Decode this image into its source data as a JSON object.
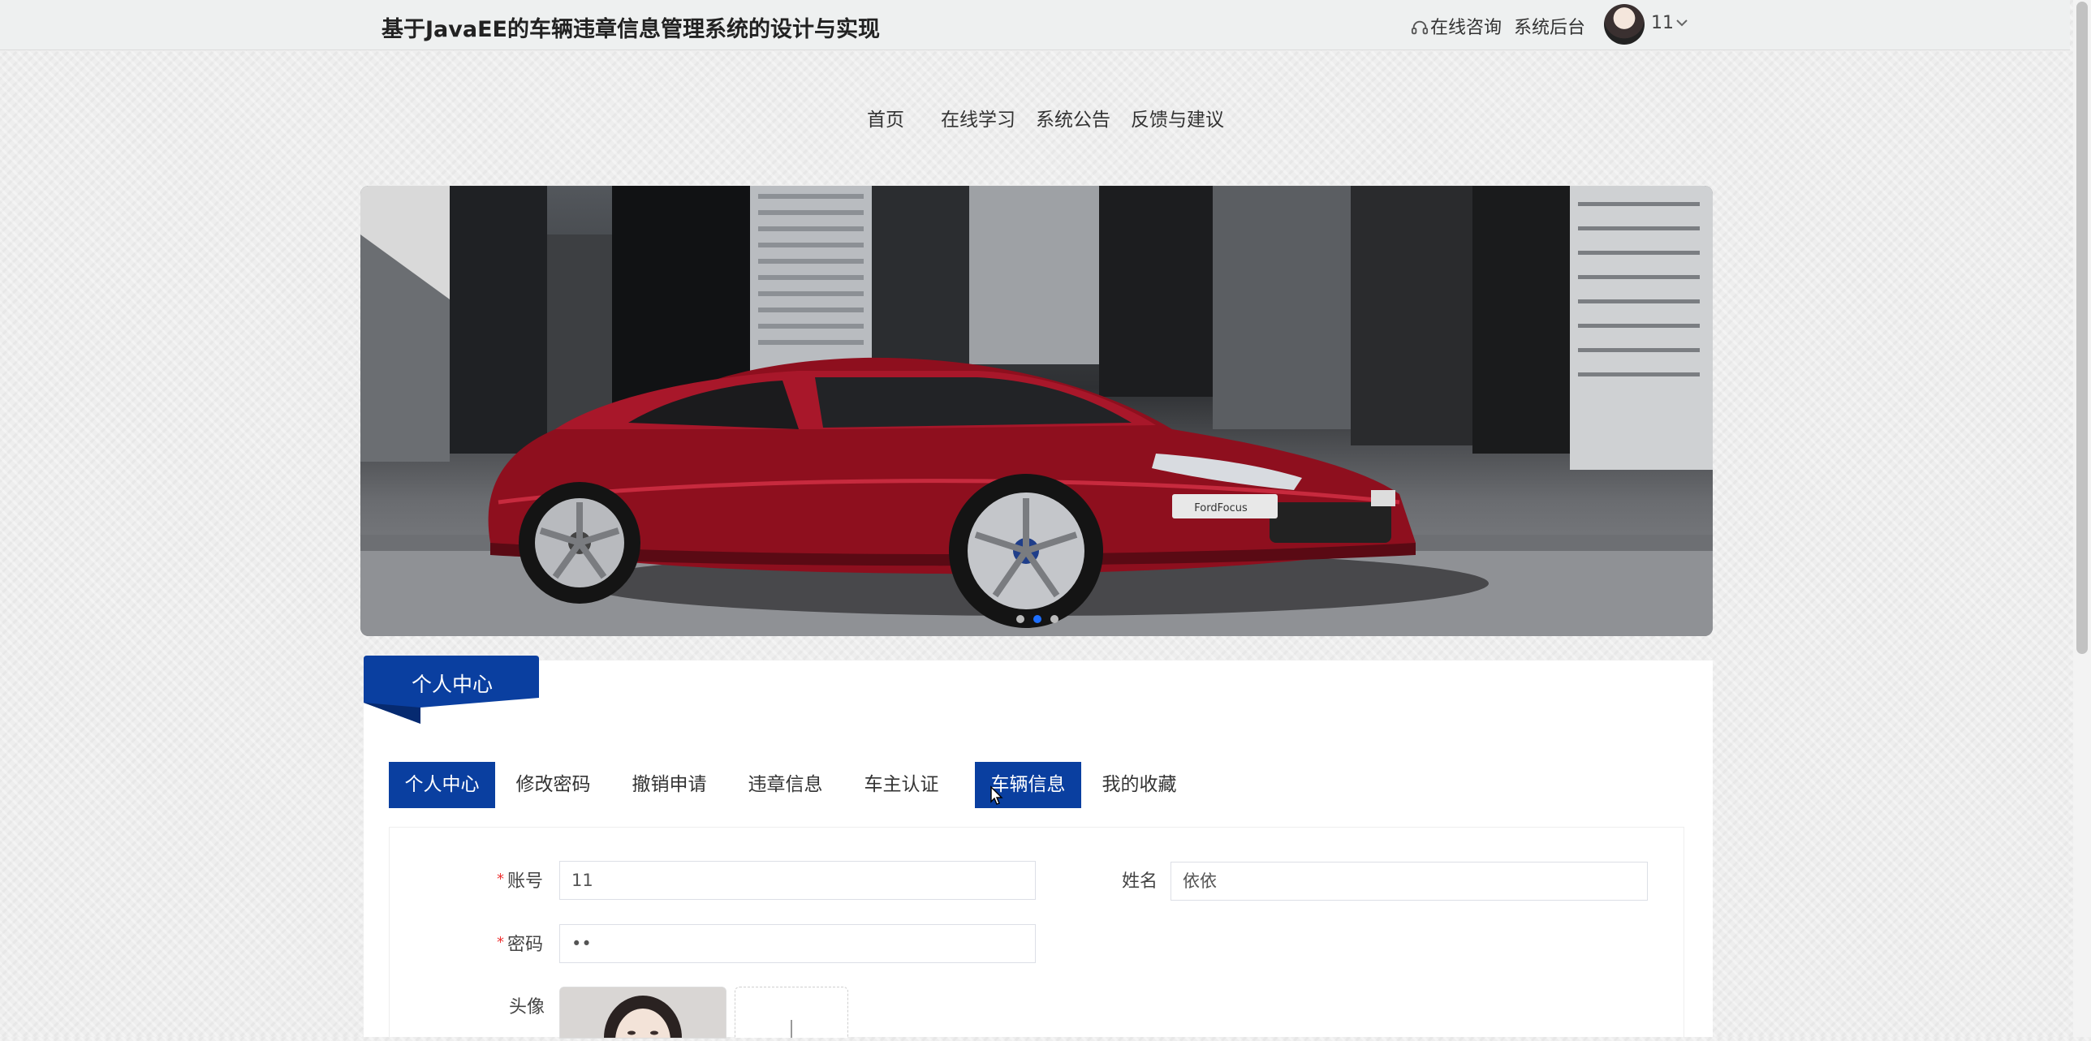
{
  "header": {
    "site_title": "基于JavaEE的车辆违章信息管理系统的设计与实现",
    "consult_label": "在线咨询",
    "backend_label": "系统后台",
    "username": "11"
  },
  "nav": {
    "items": [
      {
        "label": "首页"
      },
      {
        "label": "在线学习"
      },
      {
        "label": "系统公告"
      },
      {
        "label": "反馈与建议"
      }
    ]
  },
  "banner": {
    "plate_text": "FordFocus",
    "slide_count": 3,
    "active_slide": 2
  },
  "panel": {
    "title": "个人中心",
    "tabs": [
      {
        "label": "个人中心",
        "active": true
      },
      {
        "label": "修改密码",
        "active": false
      },
      {
        "label": "撤销申请",
        "active": false
      },
      {
        "label": "违章信息",
        "active": false
      },
      {
        "label": "车主认证",
        "active": false
      },
      {
        "label": "车辆信息",
        "active": true
      },
      {
        "label": "我的收藏",
        "active": false
      }
    ]
  },
  "form": {
    "account_label": "账号",
    "account_value": "11",
    "name_label": "姓名",
    "name_value": "依依",
    "password_label": "密码",
    "password_value": "••",
    "avatar_label": "头像",
    "required_mark": "*"
  },
  "colors": {
    "accent": "#0a3fa0",
    "active_dot": "#1e6fff",
    "required": "#ee3333"
  }
}
